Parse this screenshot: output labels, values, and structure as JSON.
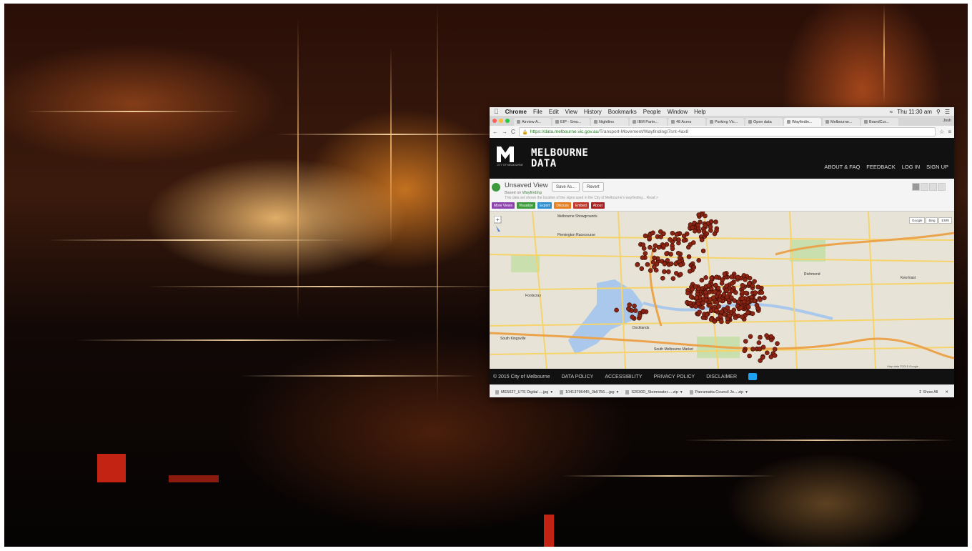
{
  "mac_menu": {
    "app": "Chrome",
    "items": [
      "File",
      "Edit",
      "View",
      "History",
      "Bookmarks",
      "People",
      "Window",
      "Help"
    ],
    "clock": "Thu 11:30 am"
  },
  "tabs": [
    "Airview A...",
    "EIP - Smu...",
    "Nightlins",
    "IBM Partn...",
    "48 Acres",
    "Parking Vic...",
    "Open data",
    "Wayfindin...",
    "Melbourne...",
    "BrandCur..."
  ],
  "tab_user": "Josh",
  "address": {
    "domain": "https://data.melbourne.vic.gov.au",
    "path": "/Transport-Movement/Wayfinding/7snt-4ax8"
  },
  "site": {
    "brand_line1": "MELBOURNE",
    "brand_line2": "DATA",
    "logo_caption": "CITY OF MELBOURNE",
    "nav": [
      "ABOUT & FAQ",
      "FEEDBACK",
      "LOG IN",
      "SIGN UP"
    ]
  },
  "view": {
    "title": "Unsaved View",
    "save_label": "Save As...",
    "revert_label": "Revert",
    "based_on_prefix": "Based on",
    "based_on": "Wayfinding",
    "description": "This data set shows the location of the signs used in the City of Melbourne's wayfinding... Read >",
    "actions": [
      {
        "label": "More Views",
        "color": "#8e44ad"
      },
      {
        "label": "Visualize",
        "color": "#3c9a3c"
      },
      {
        "label": "Export",
        "color": "#2e8fd0"
      },
      {
        "label": "Discuss",
        "color": "#e67e22"
      },
      {
        "label": "Embed",
        "color": "#c0392b"
      },
      {
        "label": "About",
        "color": "#a82020"
      }
    ]
  },
  "map": {
    "type_buttons": [
      "Google",
      "Bing",
      "ESRI"
    ],
    "labels": [
      {
        "text": "Melbourne Showgrounds"
      },
      {
        "text": "Flemington Racecourse"
      },
      {
        "text": "Kew East"
      },
      {
        "text": "Footscray"
      },
      {
        "text": "Docklands"
      },
      {
        "text": "South Melbourne Market"
      },
      {
        "text": "South Kingsville"
      },
      {
        "text": "Richmond"
      }
    ],
    "credit": "Map data ©2015 Google",
    "marker_color": "#8b2412"
  },
  "footer": {
    "copyright": "© 2015 City of Melbourne",
    "links": [
      "DATA POLICY",
      "ACCESSIBILITY",
      "PRIVACY POLICY",
      "DISCLAIMER"
    ]
  },
  "downloads": {
    "files": [
      "ME5027_UTS Digital ....jpg",
      "10413796445_3b5756....jpg",
      "S2030D_Stormwater.....zip",
      "Parramatta Council Jo....zip"
    ],
    "show_all": "Show All"
  }
}
